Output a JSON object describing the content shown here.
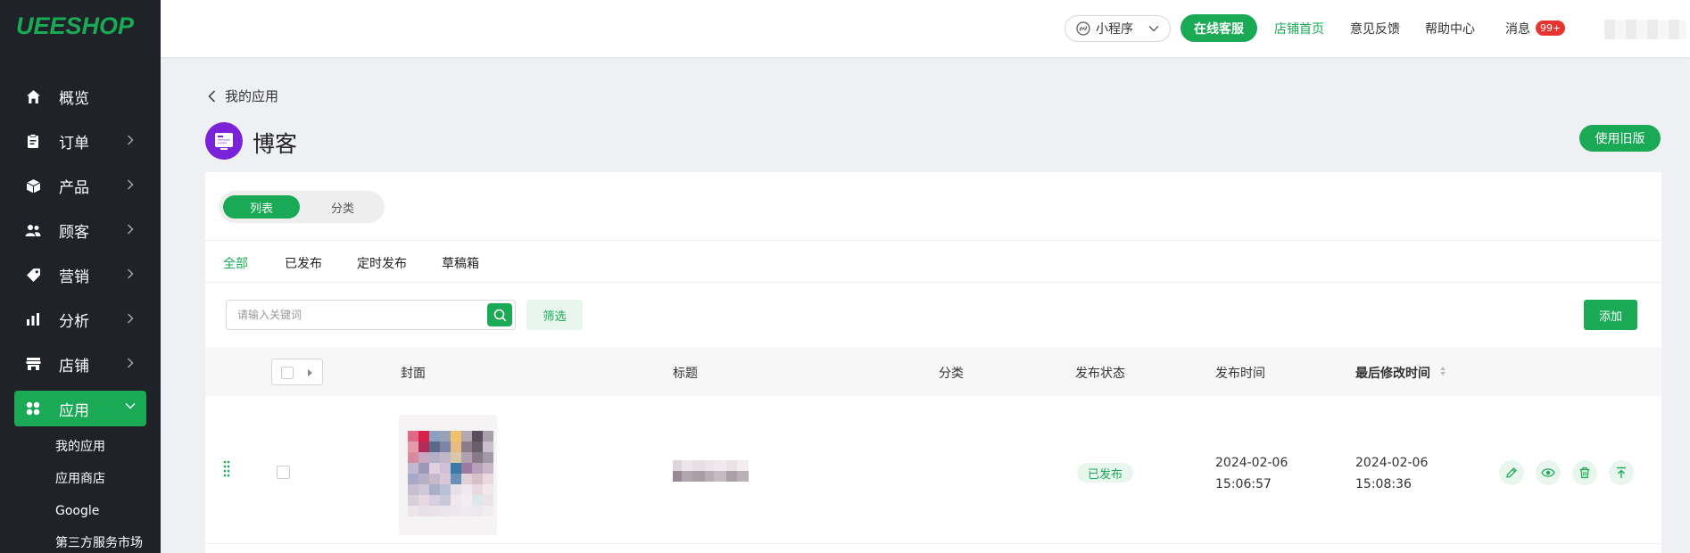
{
  "brand": {
    "logo_text": "UEESHOP",
    "accent": "#1aaa55"
  },
  "sidebar": {
    "items": [
      {
        "label": "概览",
        "icon": "home-icon"
      },
      {
        "label": "订单",
        "icon": "clipboard-icon"
      },
      {
        "label": "产品",
        "icon": "box-icon"
      },
      {
        "label": "顾客",
        "icon": "users-icon"
      },
      {
        "label": "营销",
        "icon": "tag-icon"
      },
      {
        "label": "分析",
        "icon": "bar-chart-icon"
      },
      {
        "label": "店铺",
        "icon": "store-icon"
      },
      {
        "label": "应用",
        "icon": "apps-grid-icon",
        "active": true
      }
    ],
    "sub_items": [
      "我的应用",
      "应用商店",
      "Google",
      "第三方服务市场"
    ]
  },
  "topbar": {
    "mini_program": "小程序",
    "online_service": "在线客服",
    "store_home": "店铺首页",
    "feedback": "意见反馈",
    "help": "帮助中心",
    "messages": "消息",
    "messages_badge": "99+"
  },
  "header": {
    "back_label": "我的应用",
    "title": "博客",
    "old_version_button": "使用旧版"
  },
  "view_toggle": {
    "list": "列表",
    "category": "分类"
  },
  "tabs": [
    "全部",
    "已发布",
    "定时发布",
    "草稿箱"
  ],
  "toolbar": {
    "search_placeholder": "请输入关键词",
    "filter": "筛选",
    "add": "添加"
  },
  "table": {
    "columns": {
      "cover": "封面",
      "title": "标题",
      "category": "分类",
      "status": "发布状态",
      "published": "发布时间",
      "modified": "最后修改时间"
    },
    "rows": [
      {
        "status": "已发布",
        "published_date": "2024-02-06",
        "published_time": "15:06:57",
        "modified_date": "2024-02-06",
        "modified_time": "15:08:36",
        "actions": [
          "edit-icon",
          "eye-icon",
          "trash-icon",
          "pin-top-icon"
        ]
      }
    ]
  }
}
